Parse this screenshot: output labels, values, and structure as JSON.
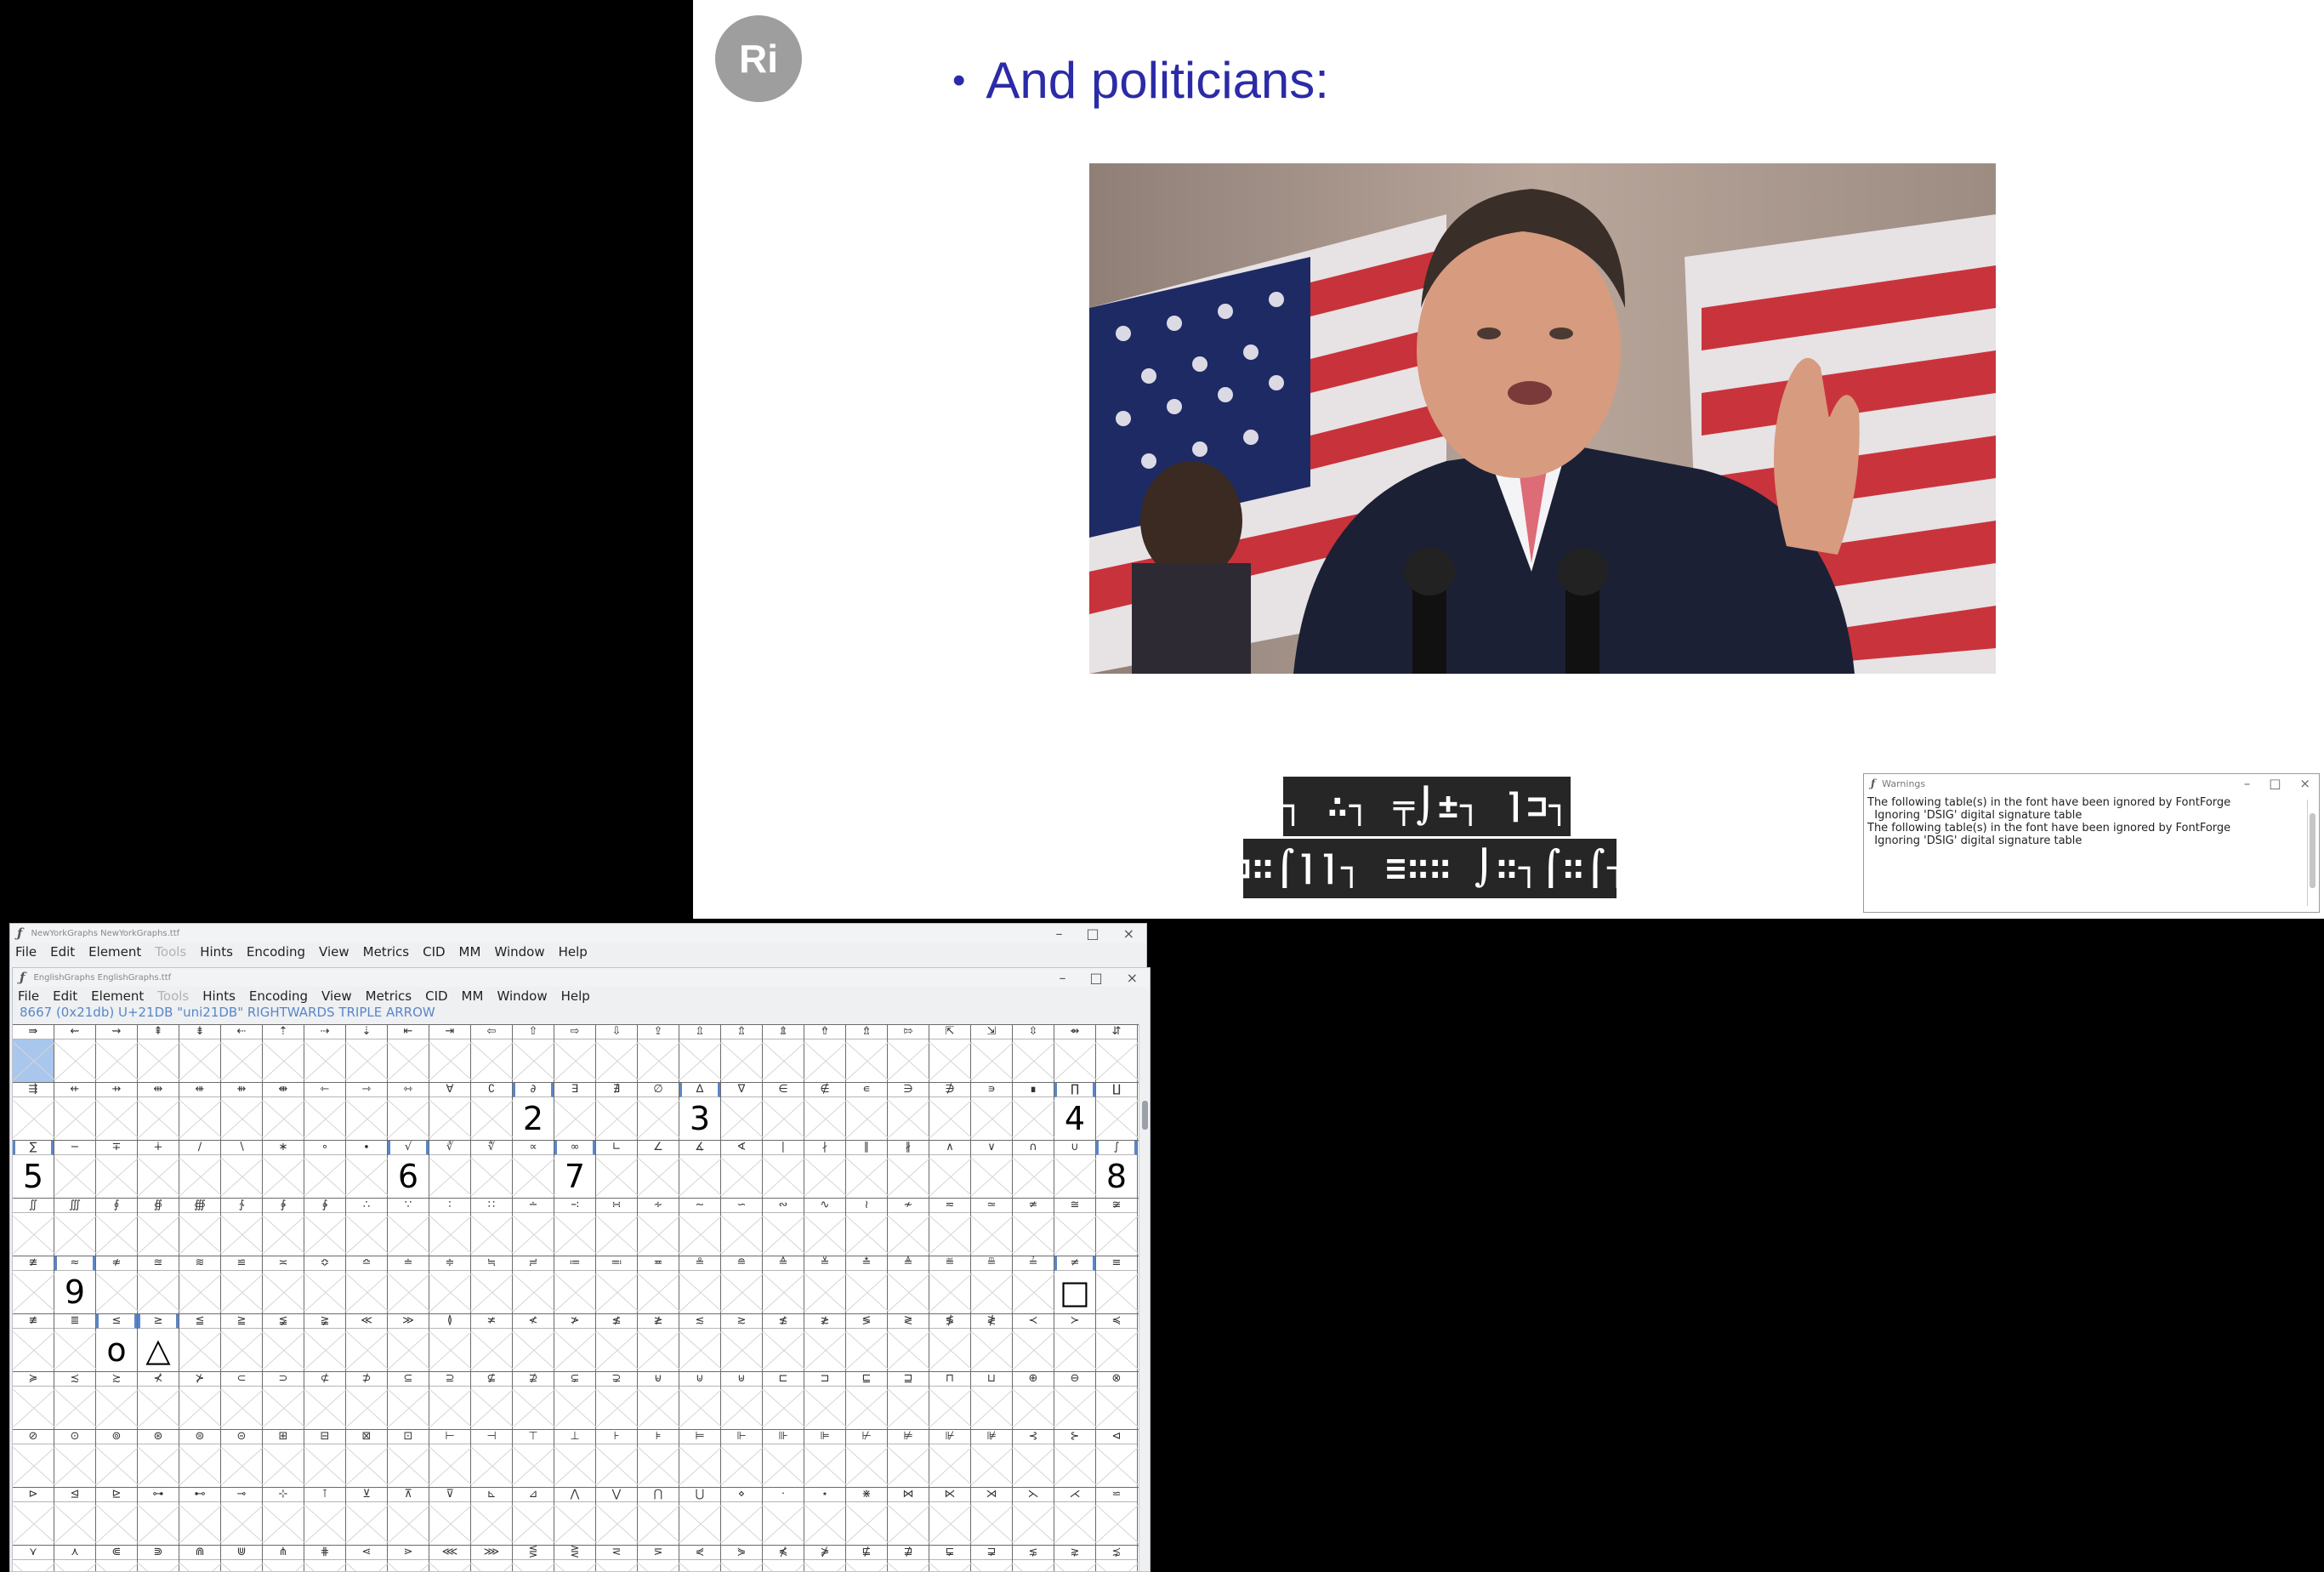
{
  "slide": {
    "avatar_initials": "Ri",
    "bullet": "And politicians:",
    "caption_line1": "╤┐∷┐ ∴┐ ╤⌡±┐ ⌉⊐┐ ⌉≡",
    "caption_line2": "⌠⌉⊐∷⌠⌉⌉┐ ≡∷∷ ⌡∷┐⌠∷⌠┐⊐⌉"
  },
  "warnings_window": {
    "title": "Warnings",
    "lines": [
      "The following table(s) in the font have been ignored by FontForge",
      "  Ignoring 'DSIG' digital signature table",
      "The following table(s) in the font have been ignored by FontForge",
      "  Ignoring 'DSIG' digital signature table"
    ]
  },
  "fontforge_back": {
    "title": "NewYorkGraphs NewYorkGraphs.ttf",
    "menu": [
      "File",
      "Edit",
      "Element",
      "Tools",
      "Hints",
      "Encoding",
      "View",
      "Metrics",
      "CID",
      "MM",
      "Window",
      "Help"
    ]
  },
  "fontforge": {
    "title": "EnglishGraphs EnglishGraphs.ttf",
    "menu": [
      "File",
      "Edit",
      "Element",
      "Tools",
      "Hints",
      "Encoding",
      "View",
      "Metrics",
      "CID",
      "MM",
      "Window",
      "Help"
    ],
    "info": "8667 (0x21db) U+21DB \"uni21DB\" RIGHTWARDS TRIPLE ARROW",
    "rows": [
      {
        "labels": [
          "⇛",
          "⇜",
          "⇝",
          "⇞",
          "⇟",
          "⇠",
          "⇡",
          "⇢",
          "⇣",
          "⇤",
          "⇥",
          "⇦",
          "⇧",
          "⇨",
          "⇩",
          "⇪",
          "⇫",
          "⇬",
          "⇭",
          "⇮",
          "⇯",
          "⇰",
          "⇱",
          "⇲",
          "⇳",
          "⇴",
          "⇵"
        ],
        "glyphs": {}
      },
      {
        "labels": [
          "⇶",
          "⇷",
          "⇸",
          "⇹",
          "⇺",
          "⇻",
          "⇼",
          "⇽",
          "⇾",
          "⇿",
          "∀",
          "∁",
          "∂",
          "∃",
          "∄",
          "∅",
          "∆",
          "∇",
          "∈",
          "∉",
          "∊",
          "∋",
          "∌",
          "∍",
          "∎",
          "∏",
          "∐"
        ],
        "glyphs": {
          "12": "2",
          "16": "3",
          "25": "4"
        }
      },
      {
        "labels": [
          "∑",
          "−",
          "∓",
          "∔",
          "∕",
          "∖",
          "∗",
          "∘",
          "∙",
          "√",
          "∛",
          "∜",
          "∝",
          "∞",
          "∟",
          "∠",
          "∡",
          "∢",
          "∣",
          "∤",
          "∥",
          "∦",
          "∧",
          "∨",
          "∩",
          "∪",
          "∫"
        ],
        "glyphs": {
          "0": "5",
          "9": "6",
          "13": "7",
          "26": "8"
        }
      },
      {
        "labels": [
          "∬",
          "∭",
          "∮",
          "∯",
          "∰",
          "∱",
          "∲",
          "∳",
          "∴",
          "∵",
          "∶",
          "∷",
          "∸",
          "∹",
          "∺",
          "∻",
          "∼",
          "∽",
          "∾",
          "∿",
          "≀",
          "≁",
          "≂",
          "≃",
          "≄",
          "≅",
          "≆"
        ],
        "glyphs": {}
      },
      {
        "labels": [
          "≇",
          "≈",
          "≉",
          "≊",
          "≋",
          "≌",
          "≍",
          "≎",
          "≏",
          "≐",
          "≑",
          "≒",
          "≓",
          "≔",
          "≕",
          "≖",
          "≗",
          "≘",
          "≙",
          "≚",
          "≛",
          "≜",
          "≝",
          "≞",
          "≟",
          "≠",
          "≡"
        ],
        "glyphs": {
          "1": "9",
          "25": "□"
        }
      },
      {
        "labels": [
          "≢",
          "≣",
          "≤",
          "≥",
          "≦",
          "≧",
          "≨",
          "≩",
          "≪",
          "≫",
          "≬",
          "≭",
          "≮",
          "≯",
          "≰",
          "≱",
          "≲",
          "≳",
          "≴",
          "≵",
          "≶",
          "≷",
          "≸",
          "≹",
          "≺",
          "≻",
          "≼"
        ],
        "glyphs": {
          "2": "o",
          "3": "△"
        }
      },
      {
        "labels": [
          "≽",
          "≾",
          "≿",
          "⊀",
          "⊁",
          "⊂",
          "⊃",
          "⊄",
          "⊅",
          "⊆",
          "⊇",
          "⊈",
          "⊉",
          "⊊",
          "⊋",
          "⊌",
          "⊍",
          "⊎",
          "⊏",
          "⊐",
          "⊑",
          "⊒",
          "⊓",
          "⊔",
          "⊕",
          "⊖",
          "⊗"
        ],
        "glyphs": {}
      },
      {
        "labels": [
          "⊘",
          "⊙",
          "⊚",
          "⊛",
          "⊜",
          "⊝",
          "⊞",
          "⊟",
          "⊠",
          "⊡",
          "⊢",
          "⊣",
          "⊤",
          "⊥",
          "⊦",
          "⊧",
          "⊨",
          "⊩",
          "⊪",
          "⊫",
          "⊬",
          "⊭",
          "⊮",
          "⊯",
          "⊰",
          "⊱",
          "⊲"
        ],
        "glyphs": {}
      },
      {
        "labels": [
          "⊳",
          "⊴",
          "⊵",
          "⊶",
          "⊷",
          "⊸",
          "⊹",
          "⊺",
          "⊻",
          "⊼",
          "⊽",
          "⊾",
          "⊿",
          "⋀",
          "⋁",
          "⋂",
          "⋃",
          "⋄",
          "⋅",
          "⋆",
          "⋇",
          "⋈",
          "⋉",
          "⋊",
          "⋋",
          "⋌",
          "⋍"
        ],
        "glyphs": {}
      },
      {
        "labels": [
          "⋎",
          "⋏",
          "⋐",
          "⋑",
          "⋒",
          "⋓",
          "⋔",
          "⋕",
          "⋖",
          "⋗",
          "⋘",
          "⋙",
          "⋚",
          "⋛",
          "⋜",
          "⋝",
          "⋞",
          "⋟",
          "⋠",
          "⋡",
          "⋢",
          "⋣",
          "⋤",
          "⋥",
          "⋦",
          "⋧",
          "⋨"
        ],
        "glyphs": {}
      }
    ],
    "selected_labels": [
      [
        2,
        0
      ],
      [
        2,
        9
      ],
      [
        2,
        13
      ],
      [
        2,
        26
      ],
      [
        4,
        1
      ],
      [
        4,
        25
      ],
      [
        5,
        2
      ],
      [
        5,
        3
      ],
      [
        1,
        12
      ],
      [
        1,
        16
      ],
      [
        1,
        25
      ]
    ],
    "current_cell": [
      0,
      0
    ]
  }
}
